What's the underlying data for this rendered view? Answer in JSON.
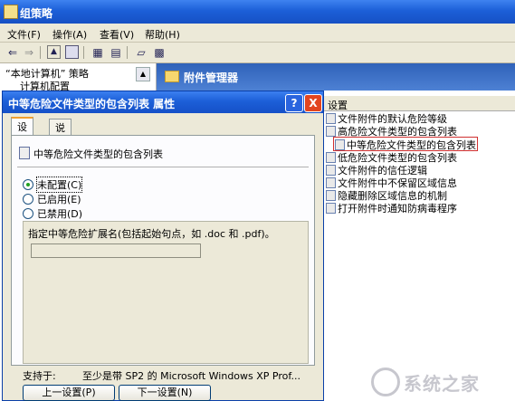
{
  "window": {
    "title": "组策略"
  },
  "menubar": {
    "items": [
      "文件(F)",
      "操作(A)",
      "查看(V)",
      "帮助(H)"
    ]
  },
  "toolbar": {
    "icons": [
      "back-arrow-icon",
      "forward-arrow-icon",
      "up-folder-icon",
      "show-tree-icon",
      "properties-icon",
      "export-icon",
      "help-icon",
      "details-icon"
    ]
  },
  "tree": {
    "items": [
      "“本地计算机” 策略",
      "计算机配置"
    ]
  },
  "right_pane": {
    "header": "附件管理器",
    "column_header": "设置",
    "settings": [
      "文件附件的默认危险等级",
      "高危险文件类型的包含列表",
      "中等危险文件类型的包含列表",
      "低危险文件类型的包含列表",
      "文件附件的信任逻辑",
      "文件附件中不保留区域信息",
      "隐藏删除区域信息的机制",
      "打开附件时通知防病毒程序"
    ],
    "selected_index": 2
  },
  "dialog": {
    "title": "中等危险文件类型的包含列表 属性",
    "help_button": "?",
    "close_button": "X",
    "tabs": [
      "设置",
      "说明"
    ],
    "active_tab": 0,
    "policy_name": "中等危险文件类型的包含列表",
    "options": [
      "未配置(C)",
      "已启用(E)",
      "已禁用(D)"
    ],
    "selected_option": 0,
    "group_label": "指定中等危险扩展名(包括起始句点，如 .doc 和 .pdf)。",
    "extension_value": "",
    "supported_label": "支持于:",
    "supported_value": "至少是带 SP2 的 Microsoft Windows XP Prof...",
    "prev_button": "上一设置(P)",
    "next_button": "下一设置(N)"
  },
  "watermark": {
    "text": "系统之家"
  }
}
